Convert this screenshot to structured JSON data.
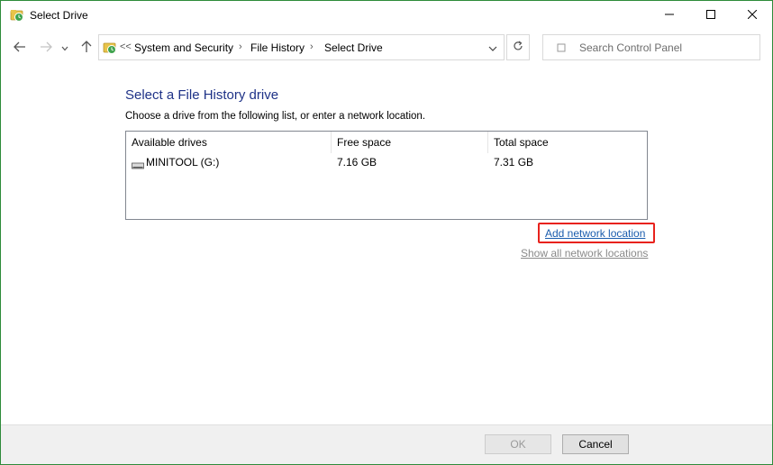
{
  "window": {
    "title": "Select Drive"
  },
  "address": {
    "overflow": "<<",
    "crumbs": [
      "System and Security",
      "File History",
      "Select Drive"
    ]
  },
  "search": {
    "placeholder": "Search Control Panel"
  },
  "main": {
    "heading": "Select a File History drive",
    "description": "Choose a drive from the following list, or enter a network location.",
    "columns": [
      "Available drives",
      "Free space",
      "Total space"
    ],
    "drives": [
      {
        "name": "MINITOOL (G:)",
        "free": "7.16 GB",
        "total": "7.31 GB"
      }
    ],
    "add_network_link": "Add network location",
    "show_network_link": "Show all network locations"
  },
  "footer": {
    "ok_label": "OK",
    "cancel_label": "Cancel"
  },
  "colors": {
    "heading": "#1e3287",
    "link": "#1a5cad",
    "highlight": "#e8221c",
    "window_border": "#2e8b3a"
  },
  "icons": [
    "file-history-icon",
    "minimize-icon",
    "maximize-icon",
    "close-icon",
    "back-arrow-icon",
    "forward-arrow-icon",
    "recent-locations-icon",
    "up-arrow-icon",
    "address-dropdown-icon",
    "refresh-icon",
    "search-icon",
    "drive-icon"
  ]
}
